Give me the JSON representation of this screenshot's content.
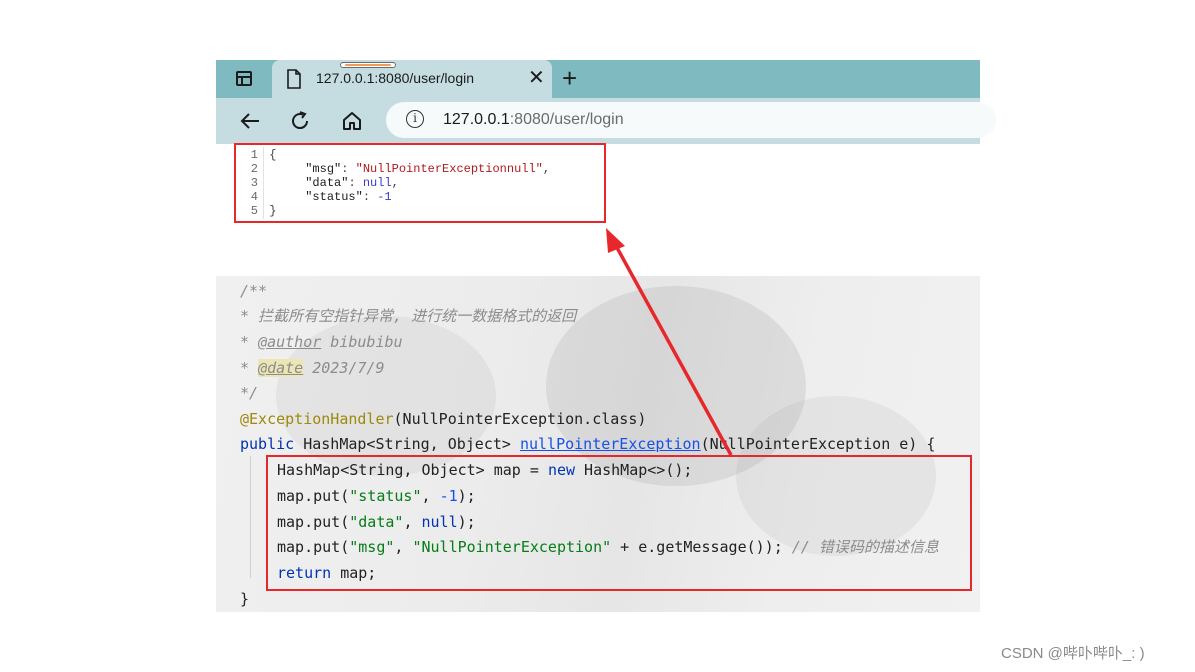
{
  "browser": {
    "tab": {
      "title": "127.0.0.1:8080/user/login",
      "close_glyph": "✕"
    },
    "new_tab_glyph": "+",
    "address_bar": {
      "host": "127.0.0.1",
      "rest": ":8080/user/login"
    },
    "icons": [
      "tab-strip-icon",
      "page-icon",
      "back-icon",
      "refresh-icon",
      "home-icon",
      "info-icon"
    ]
  },
  "json_response": {
    "line_numbers": [
      "1",
      "2",
      "3",
      "4",
      "5"
    ],
    "open_brace": "{",
    "close_brace": "}",
    "fields": [
      {
        "key": "\"msg\"",
        "value": "\"NullPointerExceptionnull\"",
        "sep": ","
      },
      {
        "key": "\"data\"",
        "value": "null",
        "sep": ","
      },
      {
        "key": "\"status\"",
        "value": "-1",
        "sep": ""
      }
    ]
  },
  "code": {
    "doc_open": "/**",
    "doc_desc": "* 拦截所有空指针异常, 进行统一数据格式的返回",
    "author_prefix": "* ",
    "author_tag": "@author",
    "author_value": " bibubibu",
    "date_prefix": "* ",
    "date_tag": "@date",
    "date_value": " 2023/7/9",
    "doc_close": "*/",
    "annotation": "@ExceptionHandler",
    "annotation_args": "(NullPointerException.class)",
    "sig_kw": "public",
    "sig_type": " HashMap<String, Object> ",
    "sig_method": "nullPointerException",
    "sig_params": "(NullPointerException e) {",
    "l1_a": "HashMap<String, Object> map = ",
    "l1_kw": "new",
    "l1_b": " HashMap<>();",
    "l2_a": "map.put(",
    "l2_str": "\"status\"",
    "l2_b": ", ",
    "l2_num": "-1",
    "l2_c": ");",
    "l3_a": "map.put(",
    "l3_str": "\"data\"",
    "l3_b": ", ",
    "l3_kw": "null",
    "l3_c": ");",
    "l4_a": "map.put(",
    "l4_str1": "\"msg\"",
    "l4_b": ", ",
    "l4_str2": "\"NullPointerException\"",
    "l4_c": " + e.getMessage()); ",
    "l4_comment": "// 错误码的描述信息",
    "l5_kw": "return",
    "l5_b": " map;",
    "close_brace": "}"
  },
  "annotations": {
    "highlight_color": "#e8272c"
  },
  "watermark": "CSDN @哔卟哔卟_: )"
}
